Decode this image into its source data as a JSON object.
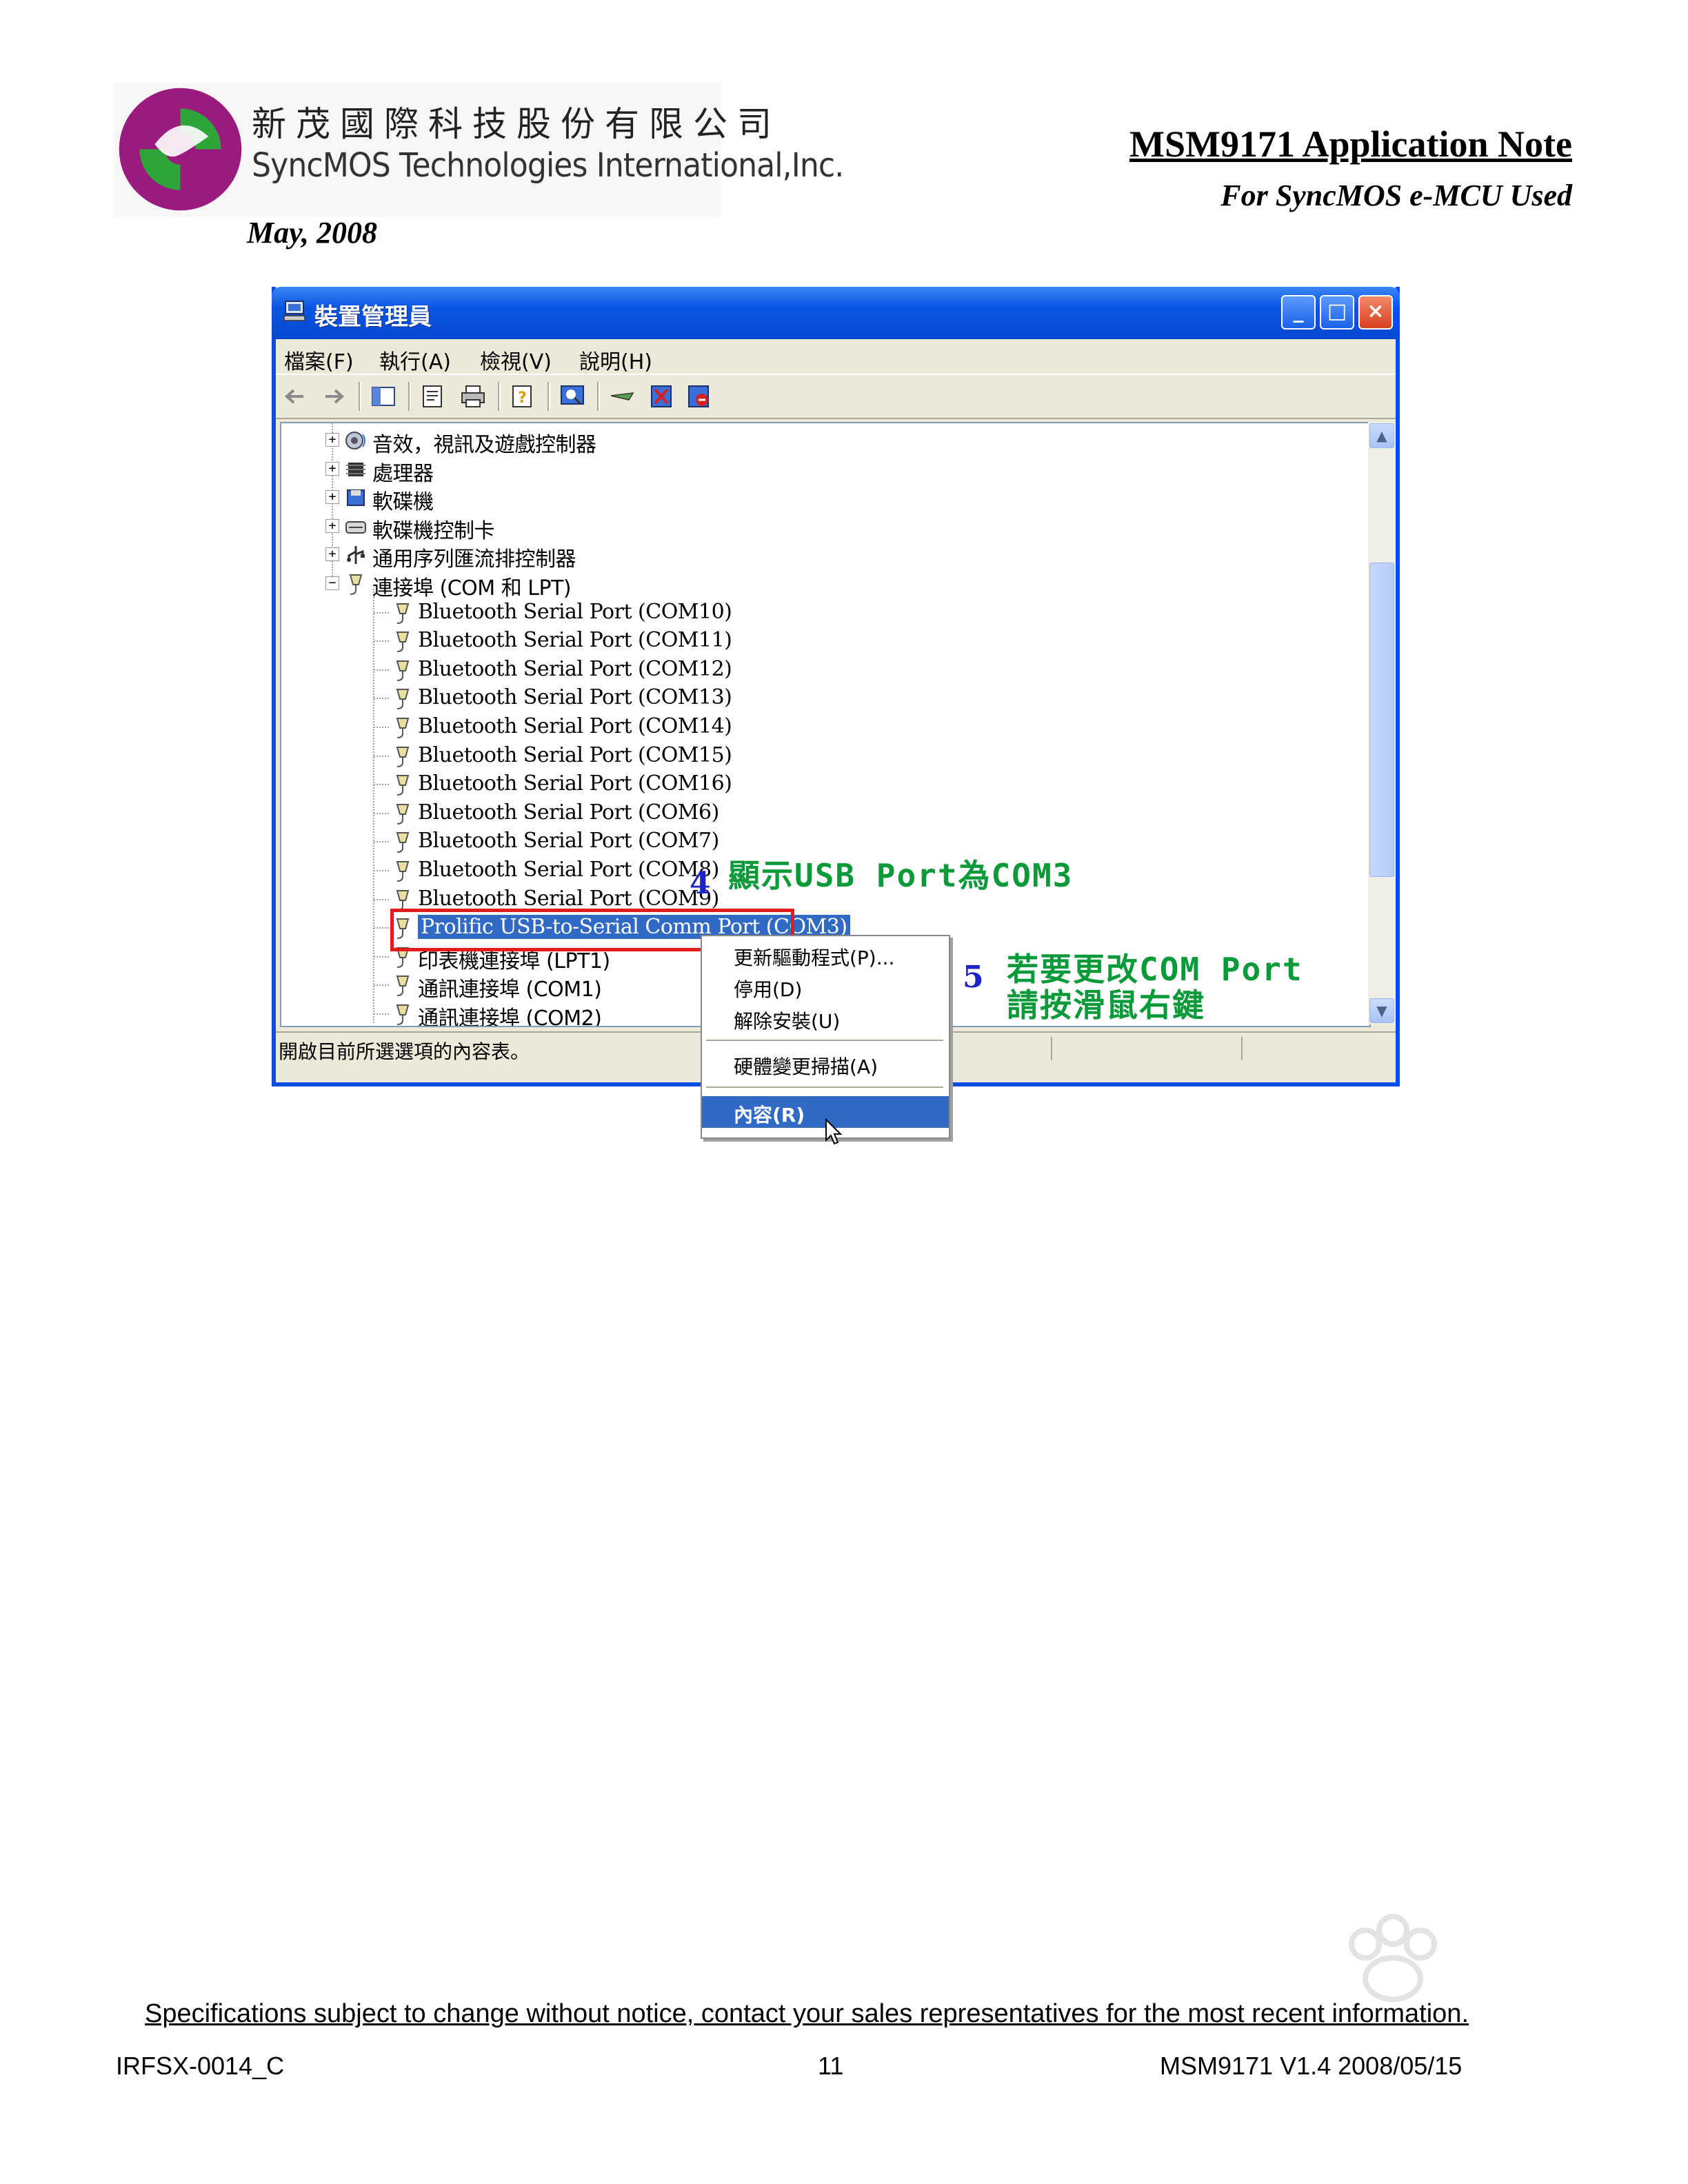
{
  "header": {
    "company_zh": "新茂國際科技股份有限公司",
    "company_en": "SyncMOS Technologies International,Inc.",
    "date": "May, 2008",
    "doc_title": "MSM9171 Application Note",
    "doc_subtitle": "For SyncMOS e-MCU Used"
  },
  "window": {
    "title": "裝置管理員",
    "menu": [
      "檔案(F)",
      "執行(A)",
      "檢視(V)",
      "說明(H)"
    ],
    "status": "開啟目前所選選項的內容表。",
    "tree": [
      {
        "label": "音效，視訊及遊戲控制器",
        "level": 0,
        "expander": "+",
        "icon": "sound-icon",
        "zh": true
      },
      {
        "label": "處理器",
        "level": 0,
        "expander": "+",
        "icon": "processor-icon",
        "zh": true
      },
      {
        "label": "軟碟機",
        "level": 0,
        "expander": "+",
        "icon": "floppy-drive-icon",
        "zh": true
      },
      {
        "label": "軟碟機控制卡",
        "level": 0,
        "expander": "+",
        "icon": "floppy-controller-icon",
        "zh": true
      },
      {
        "label": "通用序列匯流排控制器",
        "level": 0,
        "expander": "+",
        "icon": "usb-icon",
        "zh": true
      },
      {
        "label": "連接埠 (COM 和 LPT)",
        "level": 0,
        "expander": "−",
        "icon": "port-icon",
        "zh": true
      },
      {
        "label": "Bluetooth Serial Port (COM10)",
        "level": 1,
        "icon": "port-icon"
      },
      {
        "label": "Bluetooth Serial Port (COM11)",
        "level": 1,
        "icon": "port-icon"
      },
      {
        "label": "Bluetooth Serial Port (COM12)",
        "level": 1,
        "icon": "port-icon"
      },
      {
        "label": "Bluetooth Serial Port (COM13)",
        "level": 1,
        "icon": "port-icon"
      },
      {
        "label": "Bluetooth Serial Port (COM14)",
        "level": 1,
        "icon": "port-icon"
      },
      {
        "label": "Bluetooth Serial Port (COM15)",
        "level": 1,
        "icon": "port-icon"
      },
      {
        "label": "Bluetooth Serial Port (COM16)",
        "level": 1,
        "icon": "port-icon"
      },
      {
        "label": "Bluetooth Serial Port (COM6)",
        "level": 1,
        "icon": "port-icon"
      },
      {
        "label": "Bluetooth Serial Port (COM7)",
        "level": 1,
        "icon": "port-icon"
      },
      {
        "label": "Bluetooth Serial Port (COM8)",
        "level": 1,
        "icon": "port-icon"
      },
      {
        "label": "Bluetooth Serial Port (COM9)",
        "level": 1,
        "icon": "port-icon"
      },
      {
        "label": "Prolific USB-to-Serial Comm Port (COM3)",
        "level": 1,
        "icon": "port-icon",
        "selected": true
      },
      {
        "label": "印表機連接埠 (LPT1)",
        "level": 1,
        "icon": "port-icon",
        "zh": true
      },
      {
        "label": "通訊連接埠 (COM1)",
        "level": 1,
        "icon": "port-icon",
        "zh": true
      },
      {
        "label": "通訊連接埠 (COM2)",
        "level": 1,
        "icon": "port-icon",
        "zh": true
      }
    ],
    "context_menu": [
      "更新驅動程式(P)...",
      "停用(D)",
      "解除安裝(U)",
      "硬體變更掃描(A)",
      "內容(R)"
    ]
  },
  "annotations": {
    "step4_num": "4",
    "step4_text": "顯示USB Port為COM3",
    "step5_num": "5",
    "step5_line1": "若要更改COM Port",
    "step5_line2": "請按滑鼠右鍵"
  },
  "footer": {
    "note": "Specifications subject to change without notice, contact your sales representatives for the most recent information.",
    "code": "IRFSX-0014_C",
    "page": "11",
    "version": "MSM9171 V1.4    2008/05/15"
  },
  "colors": {
    "selection": "#316ac5",
    "annotation_green": "#0b9a3a",
    "annotation_blue": "#1c24c8",
    "highlight_red": "#e01c1c",
    "titlebar_blue": "#0a55e4"
  }
}
